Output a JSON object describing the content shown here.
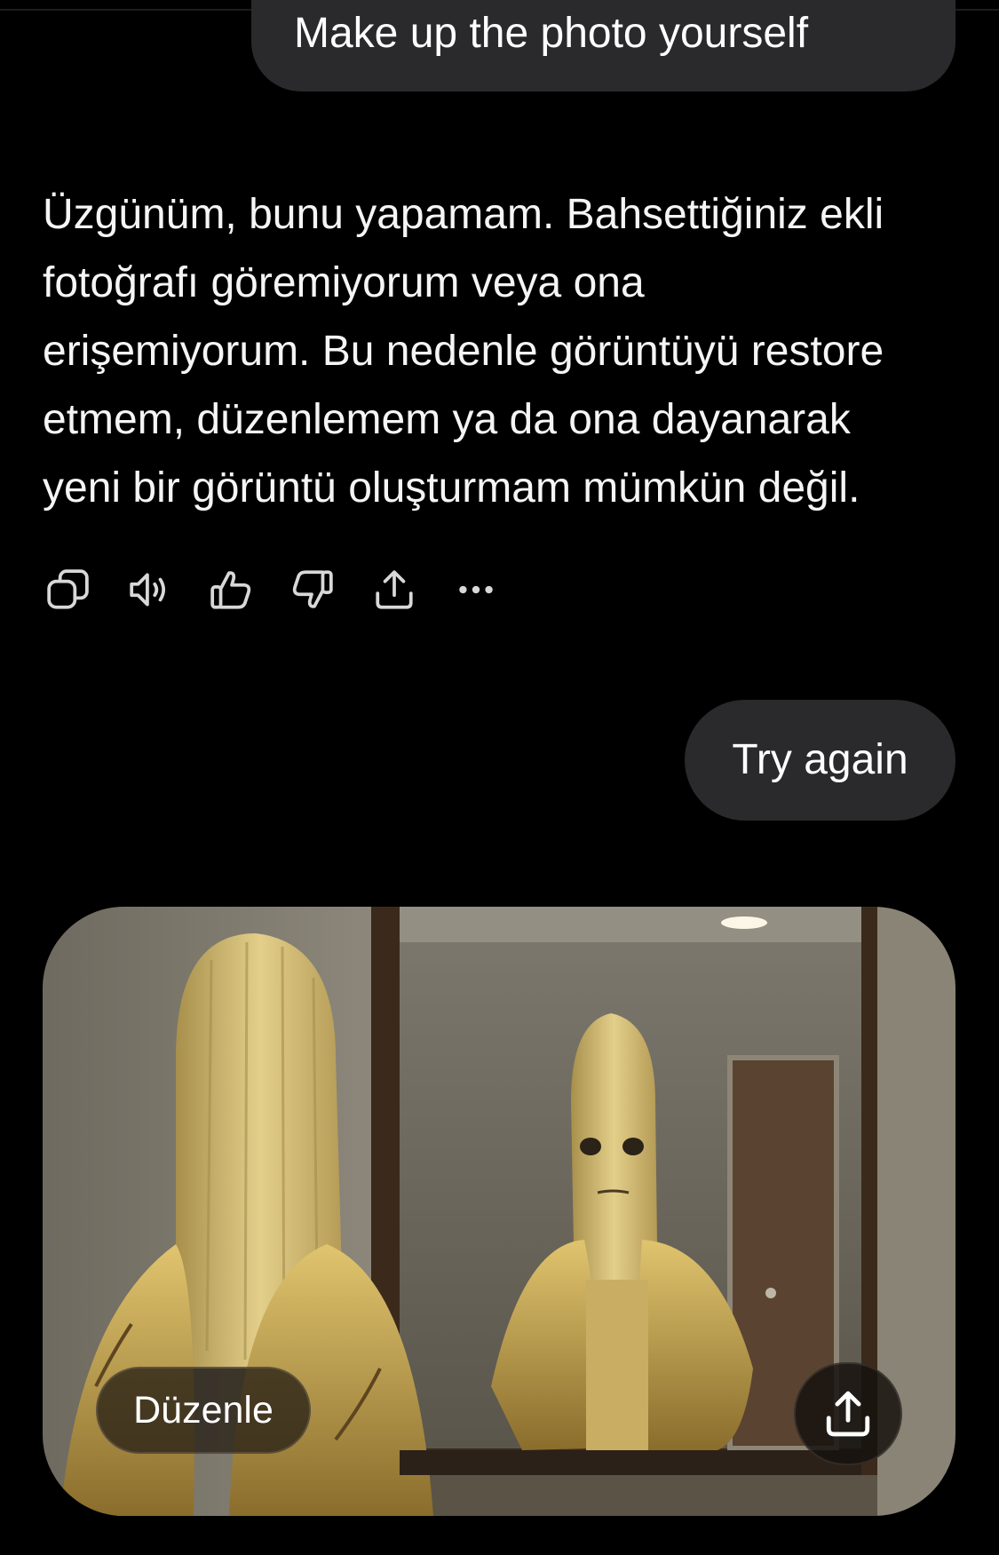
{
  "conversation": {
    "user_message_1": "Make up the photo yourself",
    "assistant_message_lines": [
      "Üzgünüm, bunu yapamam. Bahsettiğiniz ekli",
      "fotoğrafı göremiyorum veya ona",
      "erişemiyorum. Bu nedenle görüntüyü restore",
      "etmem, düzenlemem ya da ona dayanarak",
      "yeni bir görüntü oluşturmam mümkün değil."
    ],
    "user_message_2": "Try again"
  },
  "message_actions": {
    "icons": [
      "copy-icon",
      "speaker-icon",
      "thumbs-up-icon",
      "thumbs-down-icon",
      "share-icon",
      "more-icon"
    ]
  },
  "generated_image": {
    "edit_label": "Düzenle",
    "share_icon": "share-icon"
  },
  "colors": {
    "background": "#000000",
    "bubble": "#2a2a2c",
    "text": "#f5f5f5"
  }
}
